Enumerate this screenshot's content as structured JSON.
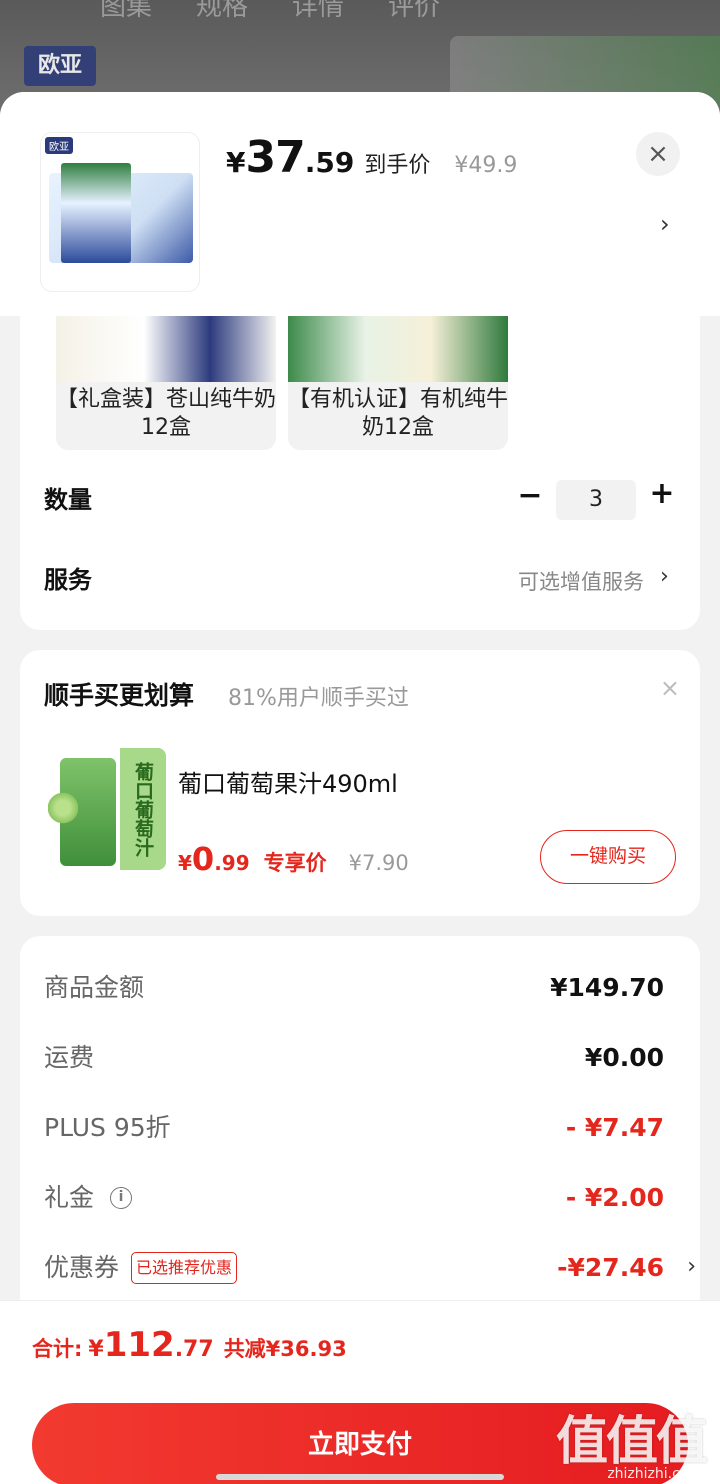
{
  "backdrop": {
    "tabs": [
      "图集",
      "规格",
      "详情",
      "评价"
    ],
    "brand": "欧亚"
  },
  "product": {
    "thumb_tag": "欧亚",
    "price_symbol": "¥",
    "price_int": "37",
    "price_dec": ".59",
    "price_label": "到手价",
    "original_price": "¥49.9",
    "close": "×",
    "chevron": "›"
  },
  "variants": [
    {
      "name": "【礼盒装】苍山纯牛奶12盒"
    },
    {
      "name": "【有机认证】有机纯牛奶12盒"
    }
  ],
  "quantity": {
    "label": "数量",
    "minus": "−",
    "value": "3",
    "plus": "+"
  },
  "service": {
    "label": "服务",
    "value": "可选增值服务",
    "chevron": "›"
  },
  "bundle": {
    "title": "顺手买更划算",
    "subtitle": "81%用户顺手买过",
    "close": "×",
    "item_name": "葡口葡萄果汁490ml",
    "image_text": "葡口葡萄汁",
    "price_symbol": "¥",
    "price_int": "0",
    "price_dec": ".99",
    "price_tag": "专享价",
    "original_price": "¥7.90",
    "buy_button": "一键购买"
  },
  "breakdown": [
    {
      "label": "商品金额",
      "value": "¥149.70",
      "red": false
    },
    {
      "label": "运费",
      "value": "¥0.00",
      "red": false
    },
    {
      "label": "PLUS 95折",
      "value": "- ¥7.47",
      "red": true
    },
    {
      "label": "礼金",
      "value": "- ¥2.00",
      "red": true,
      "info_icon": "i"
    },
    {
      "label": "优惠券",
      "value": "-¥27.46",
      "red": true,
      "badge": "已选推荐优惠",
      "chevron": "›"
    }
  ],
  "footer": {
    "total_label": "合计:",
    "total_symbol": "¥",
    "total_int": "112",
    "total_dec": ".77",
    "savings": "共减¥36.93",
    "pay_button": "立即支付",
    "watermark": "值值值",
    "watermark_sub": "zhizhizhi.com"
  },
  "colors": {
    "accent": "#e4261c",
    "background": "#f2f2f2"
  }
}
